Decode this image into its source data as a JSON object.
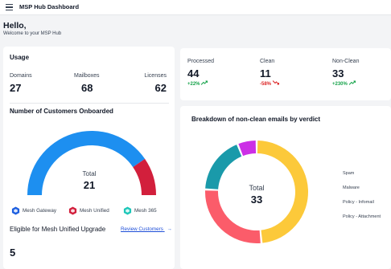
{
  "header": {
    "title": "MSP Hub Dashboard",
    "menu_icon": "hamburger-menu-icon"
  },
  "greeting": {
    "hello": "Hello,",
    "welcome": "Welcome to your MSP Hub"
  },
  "usage": {
    "title": "Usage",
    "domains_label": "Domains",
    "domains_value": "27",
    "mailboxes_label": "Mailboxes",
    "mailboxes_value": "68",
    "licenses_label": "Licenses",
    "licenses_value": "62"
  },
  "onboarded": {
    "title": "Number of Customers Onboarded",
    "total_label": "Total",
    "total_value": "21",
    "colors": {
      "mesh_gateway": "#1d8ff0",
      "mesh_unified": "#d21f3c",
      "mesh_365": "#1ec7b9"
    },
    "legend": [
      {
        "label": "Mesh Gateway",
        "icon": "mesh-gateway-hexagon-icon",
        "color": "#1d5fe0"
      },
      {
        "label": "Mesh Unified",
        "icon": "mesh-unified-hexagon-icon",
        "color": "#d21f3c"
      },
      {
        "label": "Mesh 365",
        "icon": "mesh-365-hexagon-icon",
        "color": "#1ec7b9"
      }
    ]
  },
  "eligible": {
    "label": "Eligible for Mesh Unified Upgrade",
    "value": "5",
    "review_link": "Review Customers",
    "arrow": "→"
  },
  "stats": {
    "processed": {
      "label": "Processed",
      "value": "44",
      "change": "+22%",
      "trend": "up"
    },
    "clean": {
      "label": "Clean",
      "value": "11",
      "change": "-58%",
      "trend": "down"
    },
    "non_clean": {
      "label": "Non-Clean",
      "value": "33",
      "change": "+230%",
      "trend": "up"
    }
  },
  "breakdown": {
    "title": "Breakdown of non-clean emails by verdict",
    "total_label": "Total",
    "total_value": "33",
    "verdicts": [
      "Spam",
      "Malware",
      "Policy - Infomail",
      "Policy - Attachment"
    ],
    "colors": [
      "#fcc93a",
      "#fb5c6a",
      "#1a9aaa",
      "#cc2fe6"
    ]
  },
  "chart_data": [
    {
      "type": "pie",
      "title": "Number of Customers Onboarded",
      "categories": [
        "Mesh Gateway",
        "Mesh Unified",
        "Mesh 365"
      ],
      "values": [
        17,
        4,
        0
      ],
      "total": 21
    },
    {
      "type": "pie",
      "title": "Breakdown of non-clean emails by verdict",
      "categories": [
        "Spam",
        "Malware",
        "Policy - Infomail",
        "Policy - Attachment"
      ],
      "values": [
        16,
        9,
        6,
        2
      ],
      "total": 33
    }
  ]
}
